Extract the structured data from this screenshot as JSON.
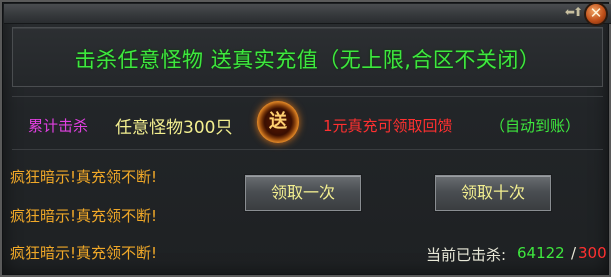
{
  "window": {
    "title": "击杀任意怪物 送真实充值（无上限,合区不关闭）",
    "arrows_glyph": "⬅⬆",
    "close_glyph": "✕"
  },
  "task": {
    "label": "累计击杀",
    "target": "任意怪物300只",
    "badge_glyph": "送",
    "reward": "1元真充可领取回馈",
    "auto_note": "（自动到账）"
  },
  "hints": [
    "疯狂暗示!真充领不断!",
    "疯狂暗示!真充领不断!",
    "疯狂暗示!真充领不断!"
  ],
  "buttons": {
    "claim_once": "领取一次",
    "claim_ten": "领取十次"
  },
  "progress": {
    "label": "当前已击杀:",
    "current": "64122",
    "separator": "/",
    "max": "300"
  },
  "colors": {
    "title_green": "#3ee83e",
    "target_yellow": "#f3ef90",
    "reward_red": "#ff3030",
    "hint_orange": "#f0a828",
    "kill_label_magenta": "#e040e0"
  }
}
